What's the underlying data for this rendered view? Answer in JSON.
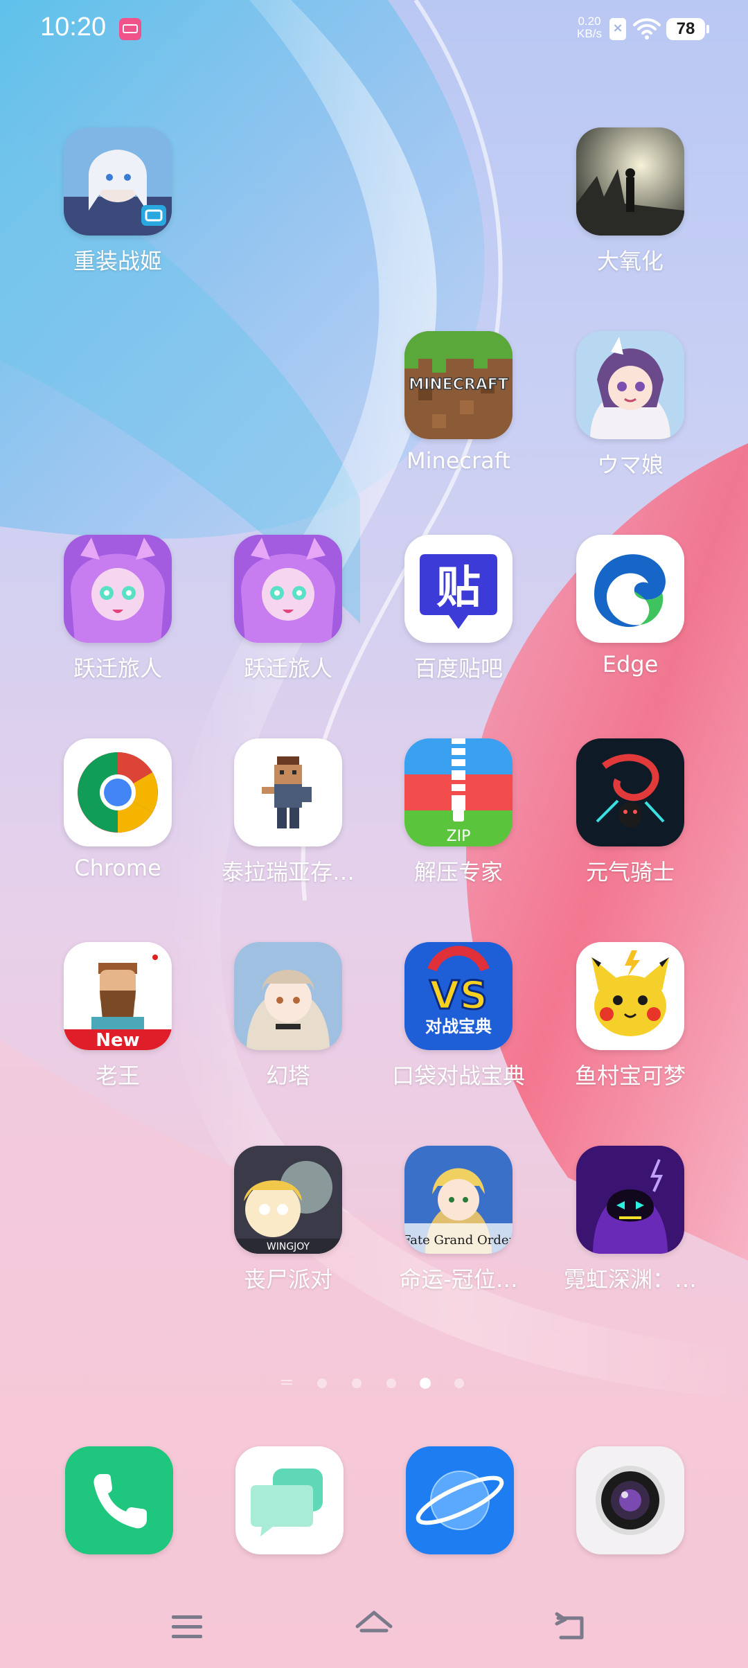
{
  "status_bar": {
    "time": "10:20",
    "net_speed_value": "0.20",
    "net_speed_unit": "KB/s",
    "battery_level": "78"
  },
  "apps": [
    {
      "label": "重装战姬",
      "icon": "anime-girl-icon"
    },
    {
      "label": "大氧化",
      "icon": "silhouette-icon"
    },
    {
      "label": "Minecraft",
      "icon": "minecraft-icon"
    },
    {
      "label": "ウマ娘",
      "icon": "uma-musume-icon"
    },
    {
      "label": "跃迁旅人",
      "icon": "purple-character-icon"
    },
    {
      "label": "跃迁旅人",
      "icon": "purple-character-icon"
    },
    {
      "label": "百度贴吧",
      "icon": "tieba-icon"
    },
    {
      "label": "Edge",
      "icon": "edge-icon"
    },
    {
      "label": "Chrome",
      "icon": "chrome-icon"
    },
    {
      "label": "泰拉瑞亚存…",
      "icon": "terraria-icon"
    },
    {
      "label": "解压专家",
      "icon": "zip-icon"
    },
    {
      "label": "元气骑士",
      "icon": "soul-knight-icon"
    },
    {
      "label": "老王",
      "icon": "bearded-man-icon",
      "badge": "New"
    },
    {
      "label": "幻塔",
      "icon": "tower-of-fantasy-icon"
    },
    {
      "label": "口袋对战宝典",
      "icon": "vs-icon",
      "icon_text": "VS",
      "icon_subtext": "对战宝典"
    },
    {
      "label": "鱼村宝可梦",
      "icon": "pikachu-icon"
    },
    {
      "label": "丧尸派对",
      "icon": "zombie-party-icon",
      "icon_text": "WINGJOY"
    },
    {
      "label": "命运-冠位…",
      "icon": "fate-icon",
      "icon_text": "Fate Grand Order"
    },
    {
      "label": "霓虹深渊：…",
      "icon": "neon-abyss-icon"
    }
  ],
  "page_indicator": {
    "count": 5,
    "active": 4
  },
  "dock": [
    {
      "name": "phone",
      "icon": "phone-icon"
    },
    {
      "name": "messages",
      "icon": "messages-icon"
    },
    {
      "name": "browser",
      "icon": "planet-browser-icon"
    },
    {
      "name": "camera",
      "icon": "camera-icon"
    }
  ],
  "nav": [
    {
      "name": "menu",
      "icon": "menu-icon"
    },
    {
      "name": "home",
      "icon": "home-icon"
    },
    {
      "name": "back",
      "icon": "back-icon"
    }
  ],
  "colors": {
    "phone": "#1ec77d",
    "browser": "#1f7df2",
    "tieba": "#3d3bd8",
    "edge_blue": "#1566c6",
    "edge_green": "#3fc35e"
  }
}
